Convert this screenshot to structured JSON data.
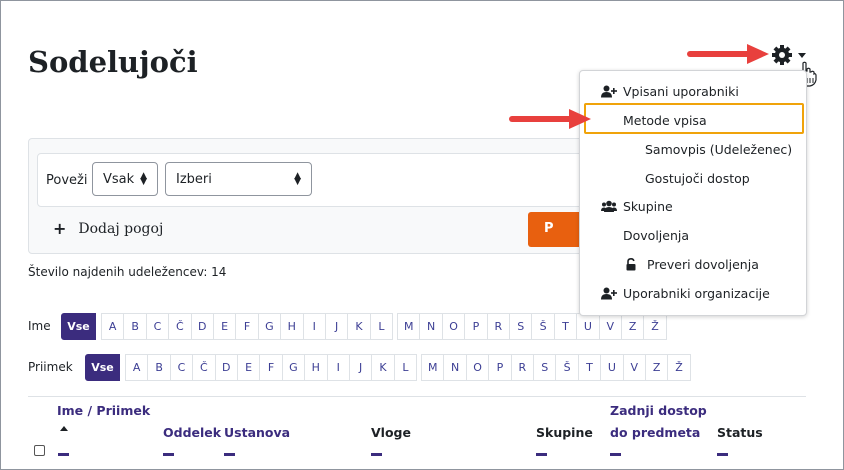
{
  "page": {
    "title": "Sodelujoči"
  },
  "filter": {
    "match_label": "Poveži",
    "match_select": "Vsak",
    "type_select": "Izberi",
    "add_condition": "Dodaj pogoj",
    "apply_button": "P"
  },
  "summary": {
    "count_text": "Število najdenih udeležencev: 14"
  },
  "initials": {
    "firstname_label": "Ime",
    "lastname_label": "Priimek",
    "all_label": "Vse",
    "letters": [
      "A",
      "B",
      "C",
      "Č",
      "D",
      "E",
      "F",
      "G",
      "H",
      "I",
      "J",
      "K",
      "L",
      "M",
      "N",
      "O",
      "P",
      "R",
      "S",
      "Š",
      "T",
      "U",
      "V",
      "Z",
      "Ž"
    ]
  },
  "table": {
    "col_name": "Ime / Priimek",
    "col_dept": "Oddelek",
    "col_inst": "Ustanova",
    "col_roles": "Vloge",
    "col_groups": "Skupine",
    "col_last_line1": "Zadnji dostop",
    "col_last_line2": "do predmeta",
    "col_status": "Status"
  },
  "menu": {
    "items": [
      {
        "label": "Vpisani uporabniki",
        "icon": "user-plus-icon"
      },
      {
        "label": "Metode vpisa",
        "icon": ""
      },
      {
        "label": "Samovpis (Udeleženec)",
        "icon": ""
      },
      {
        "label": "Gostujoči dostop",
        "icon": ""
      },
      {
        "label": "Skupine",
        "icon": "users-icon"
      },
      {
        "label": "Dovoljenja",
        "icon": ""
      },
      {
        "label": "Preveri dovoljenja",
        "icon": "unlock-icon"
      },
      {
        "label": "Uporabniki organizacije",
        "icon": "user-plus-icon"
      }
    ]
  },
  "colors": {
    "accent": "#3b2c7e",
    "apply": "#e8600f",
    "highlight": "#f0a30a",
    "arrow": "#e8403d"
  }
}
